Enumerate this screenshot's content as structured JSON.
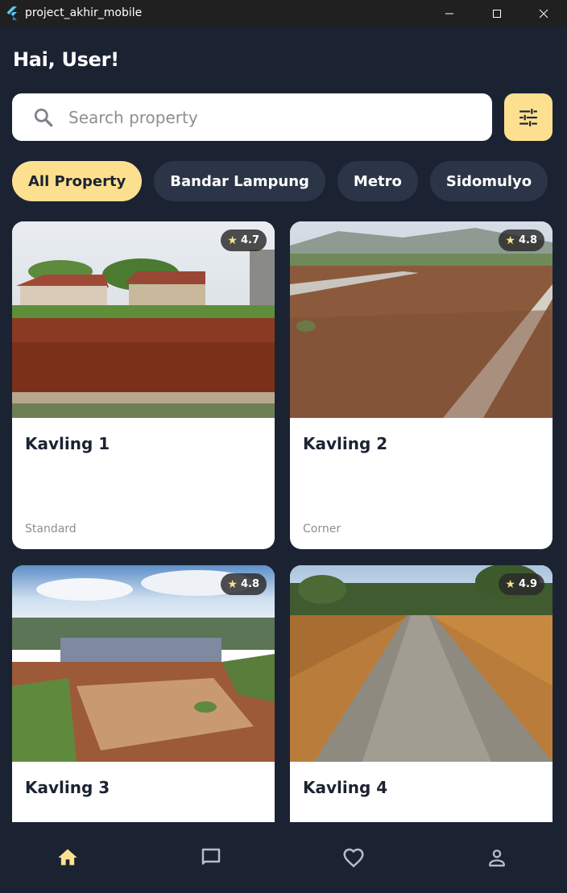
{
  "window": {
    "title": "project_akhir_mobile",
    "logo_icon": "flutter-logo-icon",
    "controls": [
      "minimize-icon",
      "maximize-icon",
      "close-icon"
    ]
  },
  "header": {
    "greeting": "Hai, User!"
  },
  "search": {
    "placeholder": "Search property",
    "value": "",
    "icon": "search-icon",
    "filter_icon": "tune-sliders-icon"
  },
  "filters": [
    {
      "label": "All Property",
      "active": true
    },
    {
      "label": "Bandar Lampung",
      "active": false
    },
    {
      "label": "Metro",
      "active": false
    },
    {
      "label": "Sidomulyo",
      "active": false
    }
  ],
  "properties": [
    {
      "title": "Kavling 1",
      "type": "Standard",
      "rating": "4.7"
    },
    {
      "title": "Kavling 2",
      "type": "Corner",
      "rating": "4.8"
    },
    {
      "title": "Kavling 3",
      "type": "",
      "rating": "4.8"
    },
    {
      "title": "Kavling 4",
      "type": "",
      "rating": "4.9"
    }
  ],
  "bottom_nav": [
    {
      "icon": "home-icon",
      "active": true
    },
    {
      "icon": "chat-icon",
      "active": false
    },
    {
      "icon": "favorite-icon",
      "active": false
    },
    {
      "icon": "profile-icon",
      "active": false
    }
  ],
  "colors": {
    "background": "#1b2333",
    "accent": "#fde08f",
    "chip_inactive": "#2c3548",
    "card": "#ffffff",
    "nav_inactive": "#b8bcc6"
  }
}
